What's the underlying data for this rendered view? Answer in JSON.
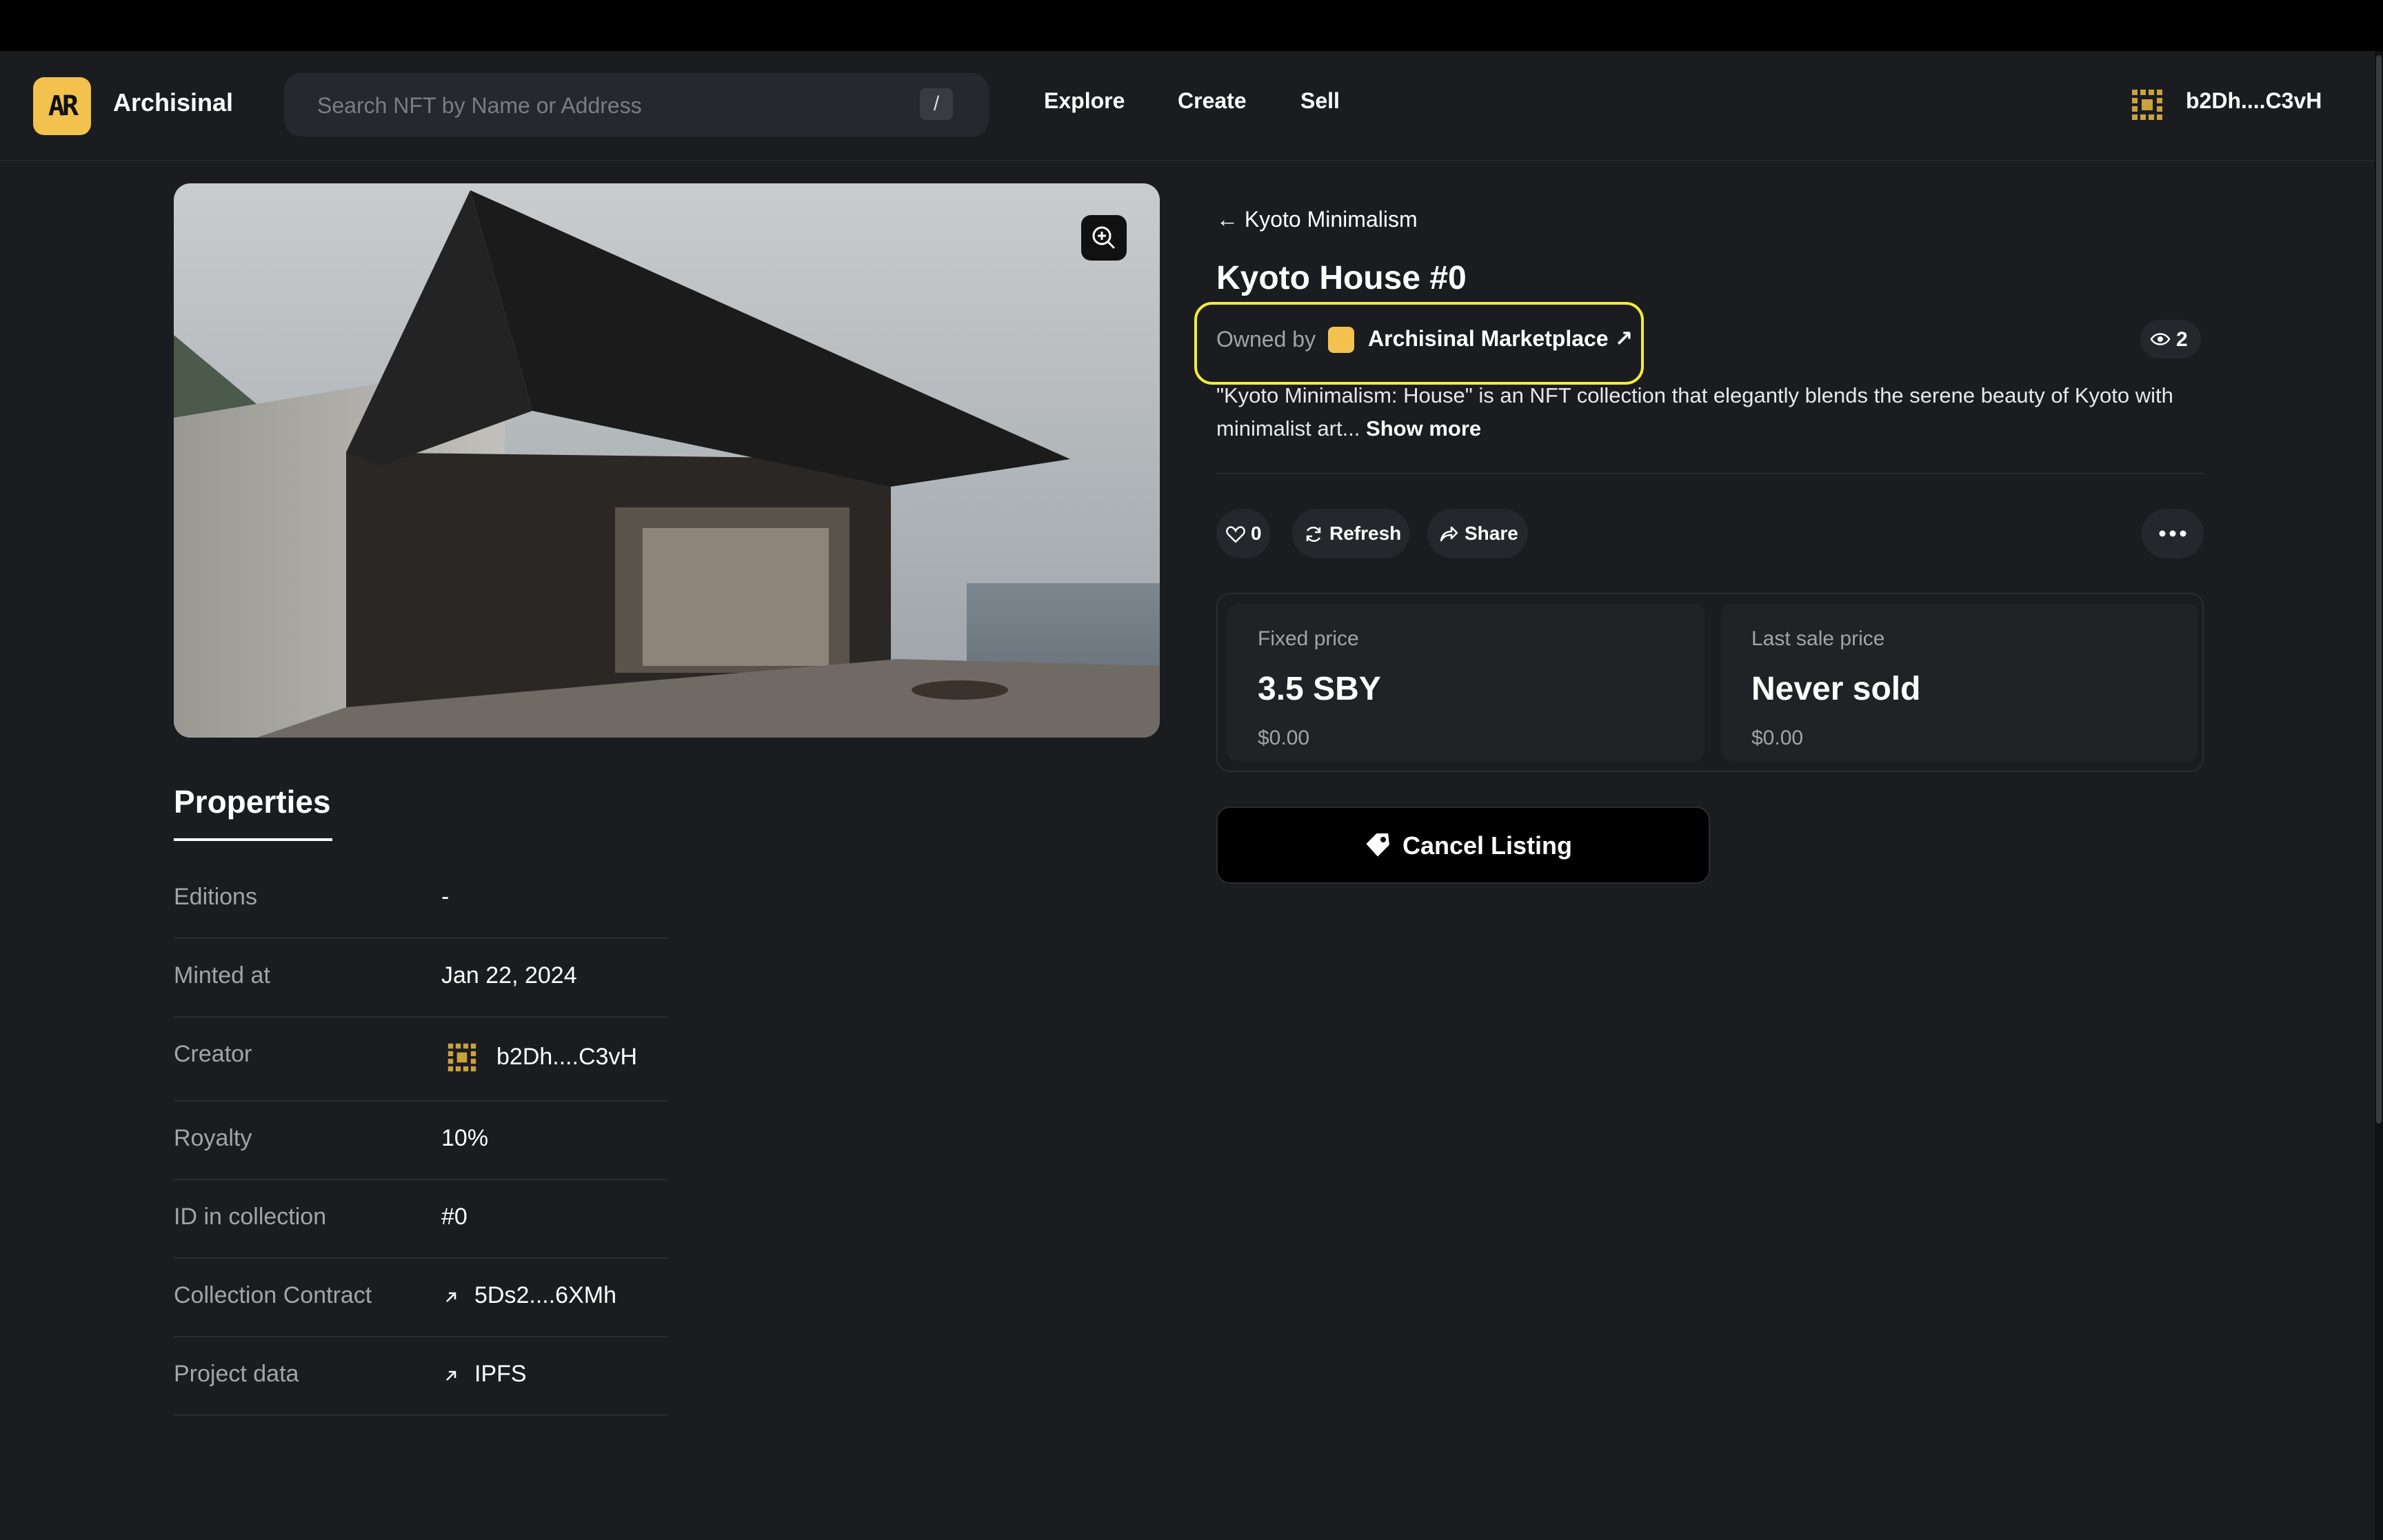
{
  "header": {
    "logo_text": "AR",
    "brand": "Archisinal",
    "search_placeholder": "Search NFT by Name or Address",
    "search_shortcut": "/",
    "nav": [
      "Explore",
      "Create",
      "Sell"
    ],
    "wallet_address": "b2Dh....C3vH"
  },
  "nft": {
    "back_label": "Kyoto Minimalism",
    "title": "Kyoto House #0",
    "owned_by_label": "Owned by",
    "owner_name": "Archisinal Marketplace",
    "views": "2",
    "description": "\"Kyoto Minimalism: House\" is an NFT collection that elegantly blends the serene beauty of Kyoto with minimalist art...",
    "show_more": "Show more",
    "likes": "0",
    "refresh_label": "Refresh",
    "share_label": "Share"
  },
  "price": {
    "fixed_label": "Fixed price",
    "fixed_value": "3.5 SBY",
    "fixed_usd": "$0.00",
    "last_sale_label": "Last sale price",
    "last_sale_value": "Never sold",
    "last_sale_usd": "$0.00"
  },
  "cancel_label": "Cancel Listing",
  "properties": {
    "title": "Properties",
    "rows": [
      {
        "label": "Editions",
        "value": "-"
      },
      {
        "label": "Minted at",
        "value": "Jan 22, 2024"
      },
      {
        "label": "Creator",
        "value": "b2Dh....C3vH"
      },
      {
        "label": "Royalty",
        "value": "10%"
      },
      {
        "label": "ID in collection",
        "value": "#0"
      },
      {
        "label": "Collection Contract",
        "value": "5Ds2....6XMh"
      },
      {
        "label": "Project data",
        "value": "IPFS"
      }
    ]
  },
  "colors": {
    "background": "#1b1c20",
    "accent": "#f2c14e",
    "highlight": "#f3ec3b"
  }
}
